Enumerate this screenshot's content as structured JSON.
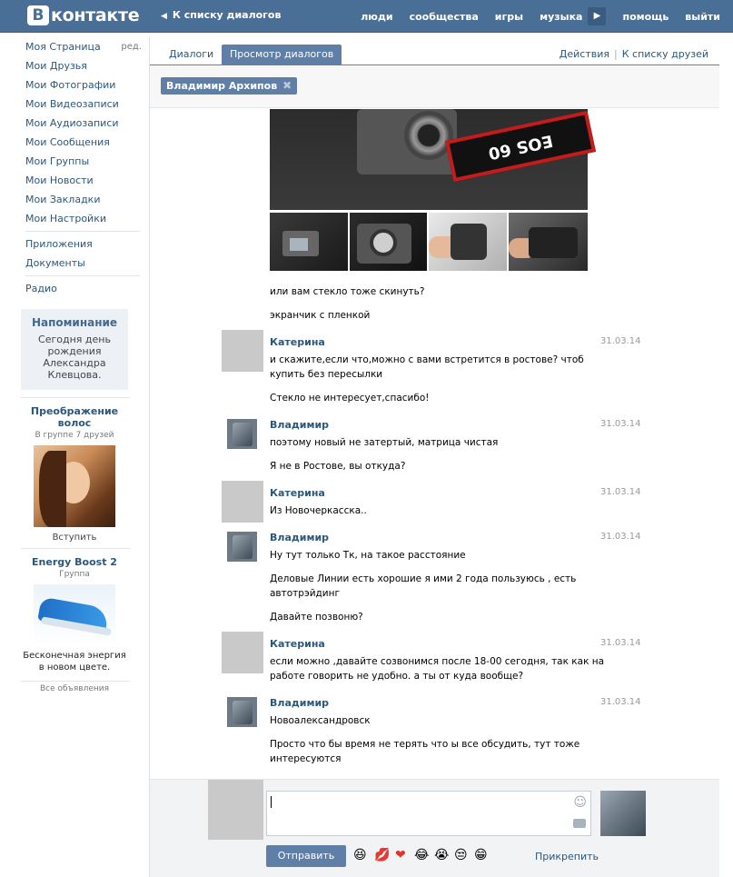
{
  "brand": {
    "logo_letter": "В",
    "logo_text": "контакте"
  },
  "top": {
    "back_link": "К списку диалогов",
    "nav": [
      "люди",
      "сообщества",
      "игры",
      "музыка",
      "помощь",
      "выйти"
    ]
  },
  "sidebar": {
    "items": [
      {
        "label": "Моя Страница",
        "extra": "ред."
      },
      {
        "label": "Мои Друзья"
      },
      {
        "label": "Мои Фотографии"
      },
      {
        "label": "Мои Видеозаписи"
      },
      {
        "label": "Мои Аудиозаписи"
      },
      {
        "label": "Мои Сообщения"
      },
      {
        "label": "Мои Группы"
      },
      {
        "label": "Мои Новости"
      },
      {
        "label": "Мои Закладки"
      },
      {
        "label": "Мои Настройки"
      }
    ],
    "extra_items": [
      "Приложения",
      "Документы"
    ],
    "radio": "Радио",
    "reminder": {
      "title": "Напоминание",
      "body": "Сегодня день рождения Александра Клевцова."
    },
    "ads": [
      {
        "title": "Преображение волос",
        "subtitle": "В группе 7 друзей",
        "action": "Вступить"
      },
      {
        "title": "Energy Boost 2",
        "subtitle": "Группа",
        "text": "Бесконечная энергия в новом цвете."
      }
    ],
    "all_ads": "Все объявления"
  },
  "tabs": {
    "dialogs": "Диалоги",
    "view": "Просмотр диалогов",
    "actions": "Действия",
    "friends": "К списку друзей"
  },
  "chip": {
    "name": "Владимир Архипов"
  },
  "messages": {
    "t1": "или вам стекло тоже скинуть?",
    "t2": "экранчик с пленкой",
    "m1": {
      "author": "Катерина",
      "date": "31.03.14",
      "l1": "и скажите,если что,можно с вами встретится в ростове? чтоб",
      "l2": "купить без пересылки",
      "l3": "Стекло не интересует,спасибо!"
    },
    "m2": {
      "author": "Владимир",
      "date": "31.03.14",
      "l1": "поэтому новый не затертый, матрица чистая",
      "l2": "Я не в Ростове, вы откуда?"
    },
    "m3": {
      "author": "Катерина",
      "date": "31.03.14",
      "l1": "Из Новочеркасска.."
    },
    "m4": {
      "author": "Владимир",
      "date": "31.03.14",
      "l1": "Ну тут только Тк, на такое расстояние",
      "l2": "Деловые Линии есть хорошие я ими 2 года пользуюсь , есть",
      "l3": "автотрэйдинг",
      "l4": "Давайте позвоню?"
    },
    "m5": {
      "author": "Катерина",
      "date": "31.03.14",
      "l1": "если можно ,давайте созвонимся после 18-00 сегодня, так как на",
      "l2": "работе говорить не удобно. а ты от куда вообще?"
    },
    "m6": {
      "author": "Владимир",
      "date": "31.03.14",
      "l1": "Новоалександровск",
      "l2": "Просто что бы время не терять что ы все обсудить, тут тоже",
      "l3": "интересуются"
    }
  },
  "compose": {
    "send": "Отправить",
    "attach": "Прикрепить",
    "emoji": [
      "😆",
      "💋",
      "❤",
      "😂",
      "😭",
      "😒",
      "😁"
    ]
  },
  "camera_strap_text": "EOS 60"
}
